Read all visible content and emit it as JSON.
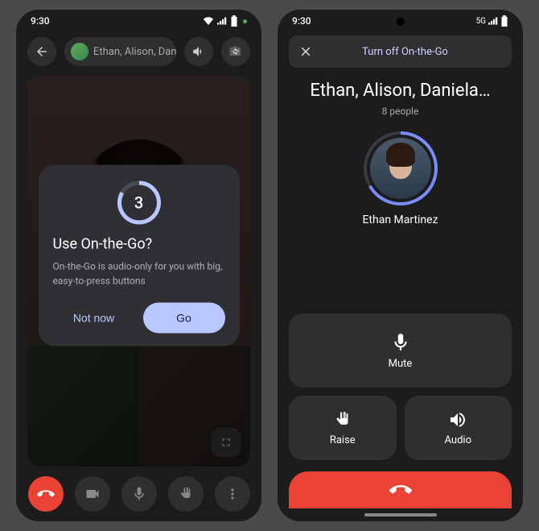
{
  "left": {
    "time": "9:30",
    "header": {
      "participants": "Ethan, Alison, Dani…"
    },
    "dialog": {
      "countdown": "3",
      "title": "Use On-the-Go?",
      "description": "On-the-Go is audio-only for you with big, easy-to-press buttons",
      "notnow": "Not now",
      "go": "Go"
    }
  },
  "right": {
    "time": "9:30",
    "network": "5G",
    "banner": {
      "label": "Turn off On-the-Go"
    },
    "title": {
      "names": "Ethan, Alison, Daniela…",
      "count": "8 people"
    },
    "speaker": {
      "name": "Ethan Martinez"
    },
    "buttons": {
      "mute": "Mute",
      "raise": "Raise",
      "audio": "Audio"
    }
  }
}
